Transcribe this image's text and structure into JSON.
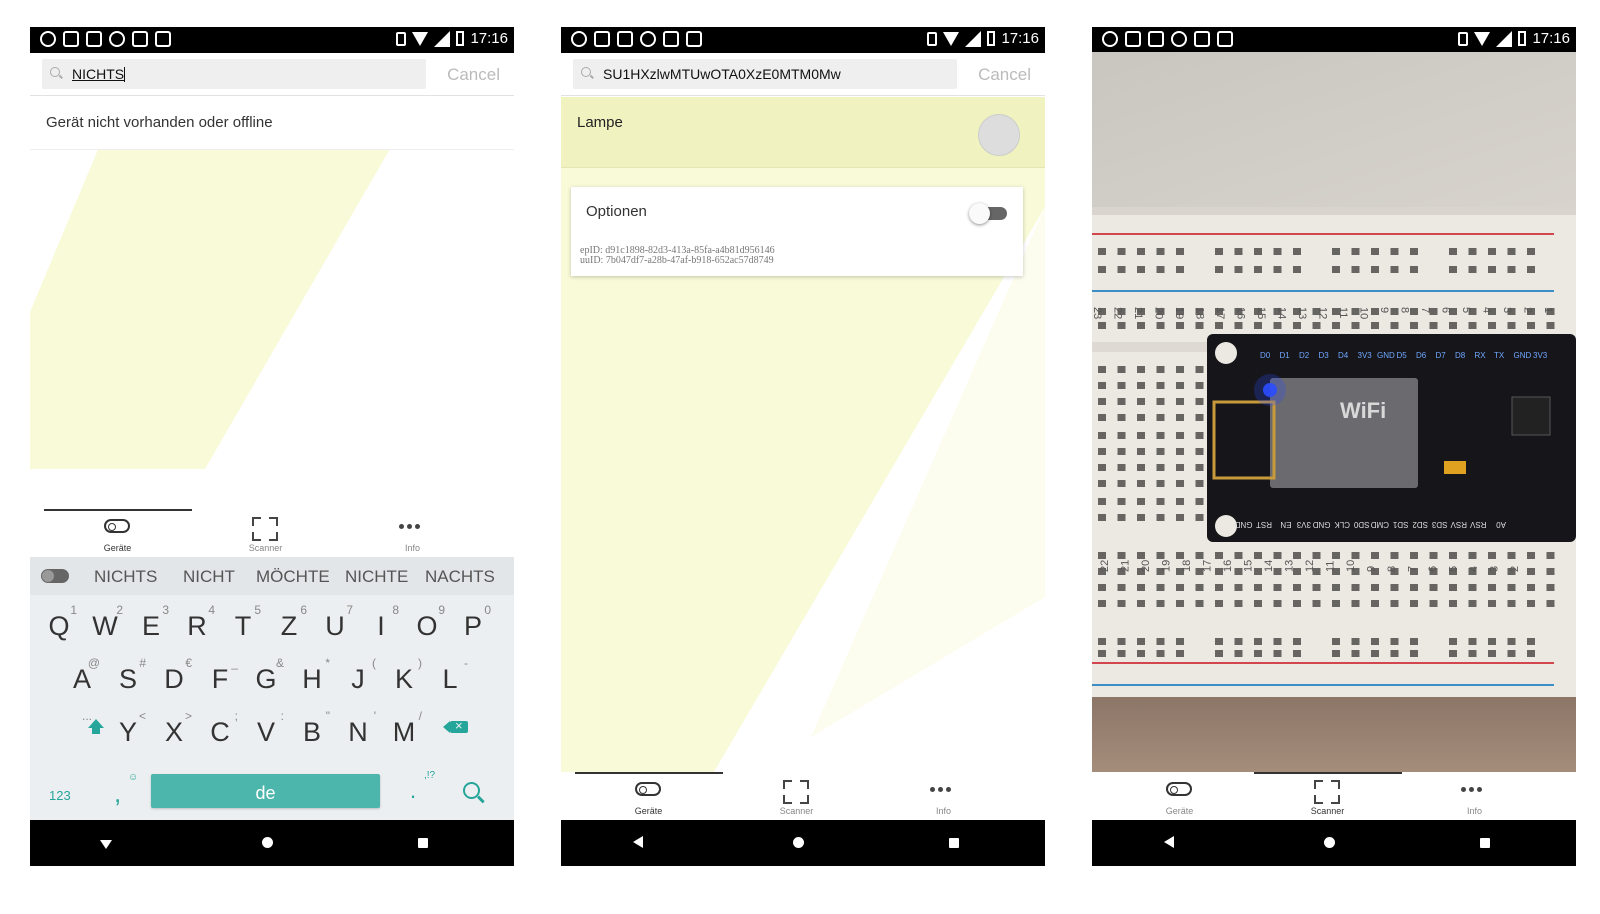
{
  "status_bar": {
    "time": "17:16"
  },
  "tabs": [
    {
      "label": "Geräte",
      "icon": "toggle-icon"
    },
    {
      "label": "Scanner",
      "icon": "scanner-icon"
    },
    {
      "label": "Info",
      "icon": "more-dots-icon"
    }
  ],
  "screen1": {
    "search_query": "NICHTS",
    "cancel_label": "Cancel",
    "message": "Gerät nicht vorhanden oder offline",
    "keyboard": {
      "suggestions": [
        "NICHTS",
        "NICHT",
        "MÖCHTE",
        "NICHTE",
        "NACHTS"
      ],
      "row1": [
        "Q",
        "W",
        "E",
        "R",
        "T",
        "Z",
        "U",
        "I",
        "O",
        "P"
      ],
      "row1_hints": [
        "1",
        "2",
        "3",
        "4",
        "5",
        "6",
        "7",
        "8",
        "9",
        "0"
      ],
      "row2": [
        "A",
        "S",
        "D",
        "F",
        "G",
        "H",
        "J",
        "K",
        "L"
      ],
      "row2_hints": [
        "@",
        "#",
        "€",
        "_",
        "&",
        "*",
        "(",
        ")",
        "-"
      ],
      "row3": [
        "Y",
        "X",
        "C",
        "V",
        "B",
        "N",
        "M"
      ],
      "row3_hints": [
        "<",
        ">",
        ";",
        ":",
        "\"",
        "'",
        "/"
      ],
      "row3_shift_hint": "...",
      "numbers_key": "123",
      "comma_key": ",",
      "emoji_hint": "☺",
      "space_label": "de",
      "period_key": ".",
      "period_hint": ",!?"
    }
  },
  "screen2": {
    "search_query": "SU1HXzlwMTUwOTA0XzE0MTM0Mw",
    "cancel_label": "Cancel",
    "device_name": "Lampe",
    "options_label": "Optionen",
    "ep_id": "epID: d91c1898-82d3-413a-85fa-a4b81d956146",
    "uu_id": "uuID: 7b047df7-a28b-47af-b918-652ac57d8749"
  },
  "breadboard": {
    "board_label": "WiFi",
    "top_numbers": [
      "23",
      "22",
      "21",
      "20",
      "19",
      "18",
      "17",
      "16",
      "15",
      "14",
      "13",
      "12",
      "11",
      "10",
      "9",
      "8",
      "7",
      "6",
      "5",
      "4",
      "3",
      "2",
      "1"
    ],
    "bottom_numbers": [
      "22",
      "21",
      "20",
      "19",
      "18",
      "17",
      "16",
      "15",
      "14",
      "13",
      "12",
      "11",
      "10",
      "9",
      "8",
      "7",
      "6",
      "5",
      "4",
      "3",
      "2"
    ],
    "top_pins": [
      "D0",
      "D1",
      "D2",
      "D3",
      "D4",
      "3V3",
      "GND",
      "D5",
      "D6",
      "D7",
      "D8",
      "RX",
      "TX",
      "GND",
      "3V3"
    ],
    "bottom_pins": [
      "A0",
      "RSV",
      "RSV",
      "SD3",
      "SD2",
      "SD1",
      "CMD",
      "SD0",
      "CLK",
      "GND",
      "3V3",
      "EN",
      "RST",
      "GND"
    ]
  },
  "colors": {
    "accent": "#26a69a",
    "pale_yellow": "#f8fad8",
    "selected_row": "#f0f3c0",
    "status_bar": "#000000"
  }
}
